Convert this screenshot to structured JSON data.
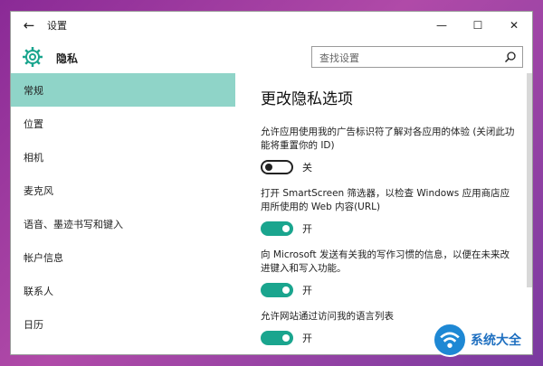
{
  "window": {
    "title": "设置",
    "controls": {
      "minimize": "—",
      "maximize": "☐",
      "close": "✕"
    }
  },
  "header": {
    "icon": "gear-icon",
    "title": "隐私",
    "search_placeholder": "查找设置"
  },
  "sidebar": {
    "items": [
      {
        "label": "常规",
        "active": true
      },
      {
        "label": "位置",
        "active": false
      },
      {
        "label": "相机",
        "active": false
      },
      {
        "label": "麦克风",
        "active": false
      },
      {
        "label": "语音、墨迹书写和键入",
        "active": false
      },
      {
        "label": "帐户信息",
        "active": false
      },
      {
        "label": "联系人",
        "active": false
      },
      {
        "label": "日历",
        "active": false
      }
    ]
  },
  "content": {
    "title": "更改隐私选项",
    "options": [
      {
        "description": "允许应用使用我的广告标识符了解对各应用的体验 (关闭此功能将重置你的 ID)",
        "state": "关"
      },
      {
        "description": "打开 SmartScreen 筛选器，以检查 Windows 应用商店应用所使用的 Web 内容(URL)",
        "state": "开"
      },
      {
        "description": "向 Microsoft 发送有关我的写作习惯的信息，以便在未来改进键入和写入功能。",
        "state": "开"
      },
      {
        "description": "允许网站通过访问我的语言列表",
        "state": "开"
      }
    ]
  },
  "watermark": {
    "text": "系统大全"
  },
  "colors": {
    "accent": "#1aa58e",
    "active_nav": "#8fd4c8"
  }
}
